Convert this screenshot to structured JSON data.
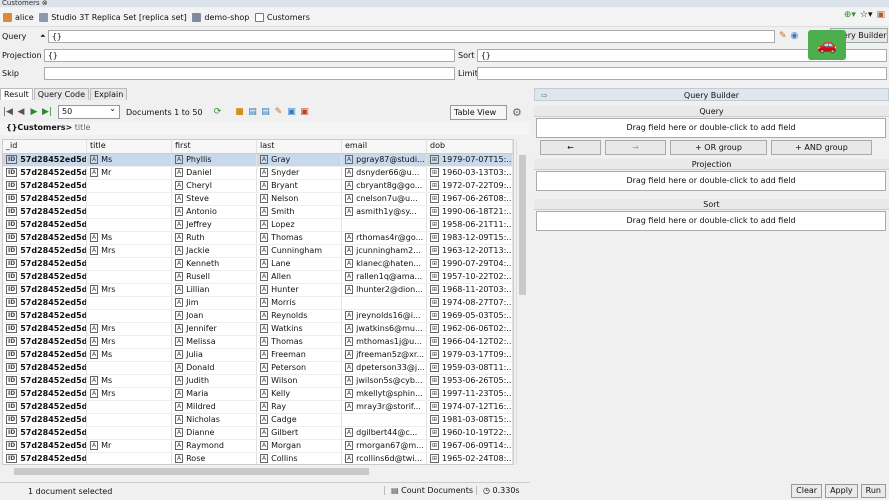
{
  "window": {
    "tab_title": "Customers ⊗"
  },
  "breadcrumb": {
    "user": "alice",
    "connection": "Studio 3T Replica Set [replica set]",
    "database": "demo-shop",
    "collection": "Customers"
  },
  "query_fields": {
    "query_label": "Query",
    "query_value": "{}",
    "projection_label": "Projection",
    "projection_value": "{}",
    "sort_label": "Sort",
    "sort_value": "{}",
    "skip_label": "Skip",
    "skip_value": "",
    "limit_label": "Limit",
    "limit_value": ""
  },
  "query_builder_button": "Query Builder",
  "result_tabs": [
    "Result",
    "Query Code",
    "Explain"
  ],
  "toolbar": {
    "page_size": "50",
    "documents_label": "Documents 1 to 50",
    "view_mode": "Table View"
  },
  "collection_path": {
    "name": "{}Customers>",
    "field": "title"
  },
  "columns": [
    "_id",
    "title",
    "first",
    "last",
    "email",
    "dob"
  ],
  "rows": [
    {
      "id": "57d28452ed5d...",
      "title": "Ms",
      "first": "Phyllis",
      "last": "Gray",
      "email": "pgray87@studi...",
      "dob": "1979-07-07T15:..."
    },
    {
      "id": "57d28452ed5d...",
      "title": "Mr",
      "first": "Daniel",
      "last": "Snyder",
      "email": "dsnyder66@u...",
      "dob": "1960-03-13T03:..."
    },
    {
      "id": "57d28452ed5d...",
      "title": "",
      "first": "Cheryl",
      "last": "Bryant",
      "email": "cbryant8g@go...",
      "dob": "1972-07-22T09:..."
    },
    {
      "id": "57d28452ed5d...",
      "title": "",
      "first": "Steve",
      "last": "Nelson",
      "email": "cnelson7u@u...",
      "dob": "1967-06-26T08:..."
    },
    {
      "id": "57d28452ed5d...",
      "title": "",
      "first": "Antonio",
      "last": "Smith",
      "email": "asmith1y@sy...",
      "dob": "1990-06-18T21:..."
    },
    {
      "id": "57d28452ed5d...",
      "title": "",
      "first": "Jeffrey",
      "last": "Lopez",
      "email": "",
      "dob": "1958-06-21T11:..."
    },
    {
      "id": "57d28452ed5d...",
      "title": "Ms",
      "first": "Ruth",
      "last": "Thomas",
      "email": "rthomas4r@go...",
      "dob": "1983-12-09T15:..."
    },
    {
      "id": "57d28452ed5d...",
      "title": "Mrs",
      "first": "Jackie",
      "last": "Cunningham",
      "email": "jcunningham2...",
      "dob": "1963-12-20T13:..."
    },
    {
      "id": "57d28452ed5d...",
      "title": "",
      "first": "Kenneth",
      "last": "Lane",
      "email": "klanec@haten...",
      "dob": "1990-07-29T04:..."
    },
    {
      "id": "57d28452ed5d...",
      "title": "",
      "first": "Rusell",
      "last": "Allen",
      "email": "rallen1q@ama...",
      "dob": "1957-10-22T02:..."
    },
    {
      "id": "57d28452ed5d...",
      "title": "Mrs",
      "first": "Lillian",
      "last": "Hunter",
      "email": "lhunter2@dion...",
      "dob": "1968-11-20T03:..."
    },
    {
      "id": "57d28452ed5d...",
      "title": "",
      "first": "Jim",
      "last": "Morris",
      "email": "",
      "dob": "1974-08-27T07:..."
    },
    {
      "id": "57d28452ed5d...",
      "title": "",
      "first": "Joan",
      "last": "Reynolds",
      "email": "jreynolds16@i...",
      "dob": "1969-05-03T05:..."
    },
    {
      "id": "57d28452ed5d...",
      "title": "Mrs",
      "first": "Jennifer",
      "last": "Watkins",
      "email": "jwatkins6@mu...",
      "dob": "1962-06-06T02:..."
    },
    {
      "id": "57d28452ed5d...",
      "title": "Mrs",
      "first": "Melissa",
      "last": "Thomas",
      "email": "mthomas1j@u...",
      "dob": "1966-04-12T02:..."
    },
    {
      "id": "57d28452ed5d...",
      "title": "Ms",
      "first": "Julia",
      "last": "Freeman",
      "email": "jfreeman5z@xr...",
      "dob": "1979-03-17T09:..."
    },
    {
      "id": "57d28452ed5d...",
      "title": "",
      "first": "Donald",
      "last": "Peterson",
      "email": "dpeterson33@j...",
      "dob": "1959-03-08T11:..."
    },
    {
      "id": "57d28452ed5d...",
      "title": "Ms",
      "first": "Judith",
      "last": "Wilson",
      "email": "jwilson5s@cyb...",
      "dob": "1953-06-26T05:..."
    },
    {
      "id": "57d28452ed5d...",
      "title": "Mrs",
      "first": "Maria",
      "last": "Kelly",
      "email": "mkellyt@sphin...",
      "dob": "1997-11-23T05:..."
    },
    {
      "id": "57d28452ed5d...",
      "title": "",
      "first": "Mildred",
      "last": "Ray",
      "email": "mray3r@storif...",
      "dob": "1974-07-12T16:..."
    },
    {
      "id": "57d28452ed5d...",
      "title": "",
      "first": "Nicholas",
      "last": "Cadge",
      "email": "",
      "dob": "1981-03-08T15:..."
    },
    {
      "id": "57d28452ed5d...",
      "title": "",
      "first": "Dianne",
      "last": "Gilbert",
      "email": "dgilbert44@c...",
      "dob": "1960-10-19T22:..."
    },
    {
      "id": "57d28452ed5d...",
      "title": "Mr",
      "first": "Raymond",
      "last": "Morgan",
      "email": "rmorgan67@m...",
      "dob": "1967-06-09T14:..."
    },
    {
      "id": "57d28452ed5d...",
      "title": "",
      "first": "Rose",
      "last": "Collins",
      "email": "rcollins6d@twi...",
      "dob": "1965-02-24T08:..."
    }
  ],
  "status": {
    "selection": "1 document selected",
    "count_button": "Count Documents",
    "time": "0.330s"
  },
  "query_builder": {
    "title": "Query Builder",
    "query_header": "Query",
    "projection_header": "Projection",
    "sort_header": "Sort",
    "drop_hint": "Drag field here or double-click to add field",
    "buttons": [
      "←",
      "→",
      "+ OR group",
      "+ AND group"
    ]
  },
  "bottom_buttons": [
    "Clear",
    "Apply",
    "Run"
  ],
  "colors": {
    "selection": "#c8d9ec",
    "header": "#dfe6ee",
    "accent_green": "#4cae4c"
  }
}
